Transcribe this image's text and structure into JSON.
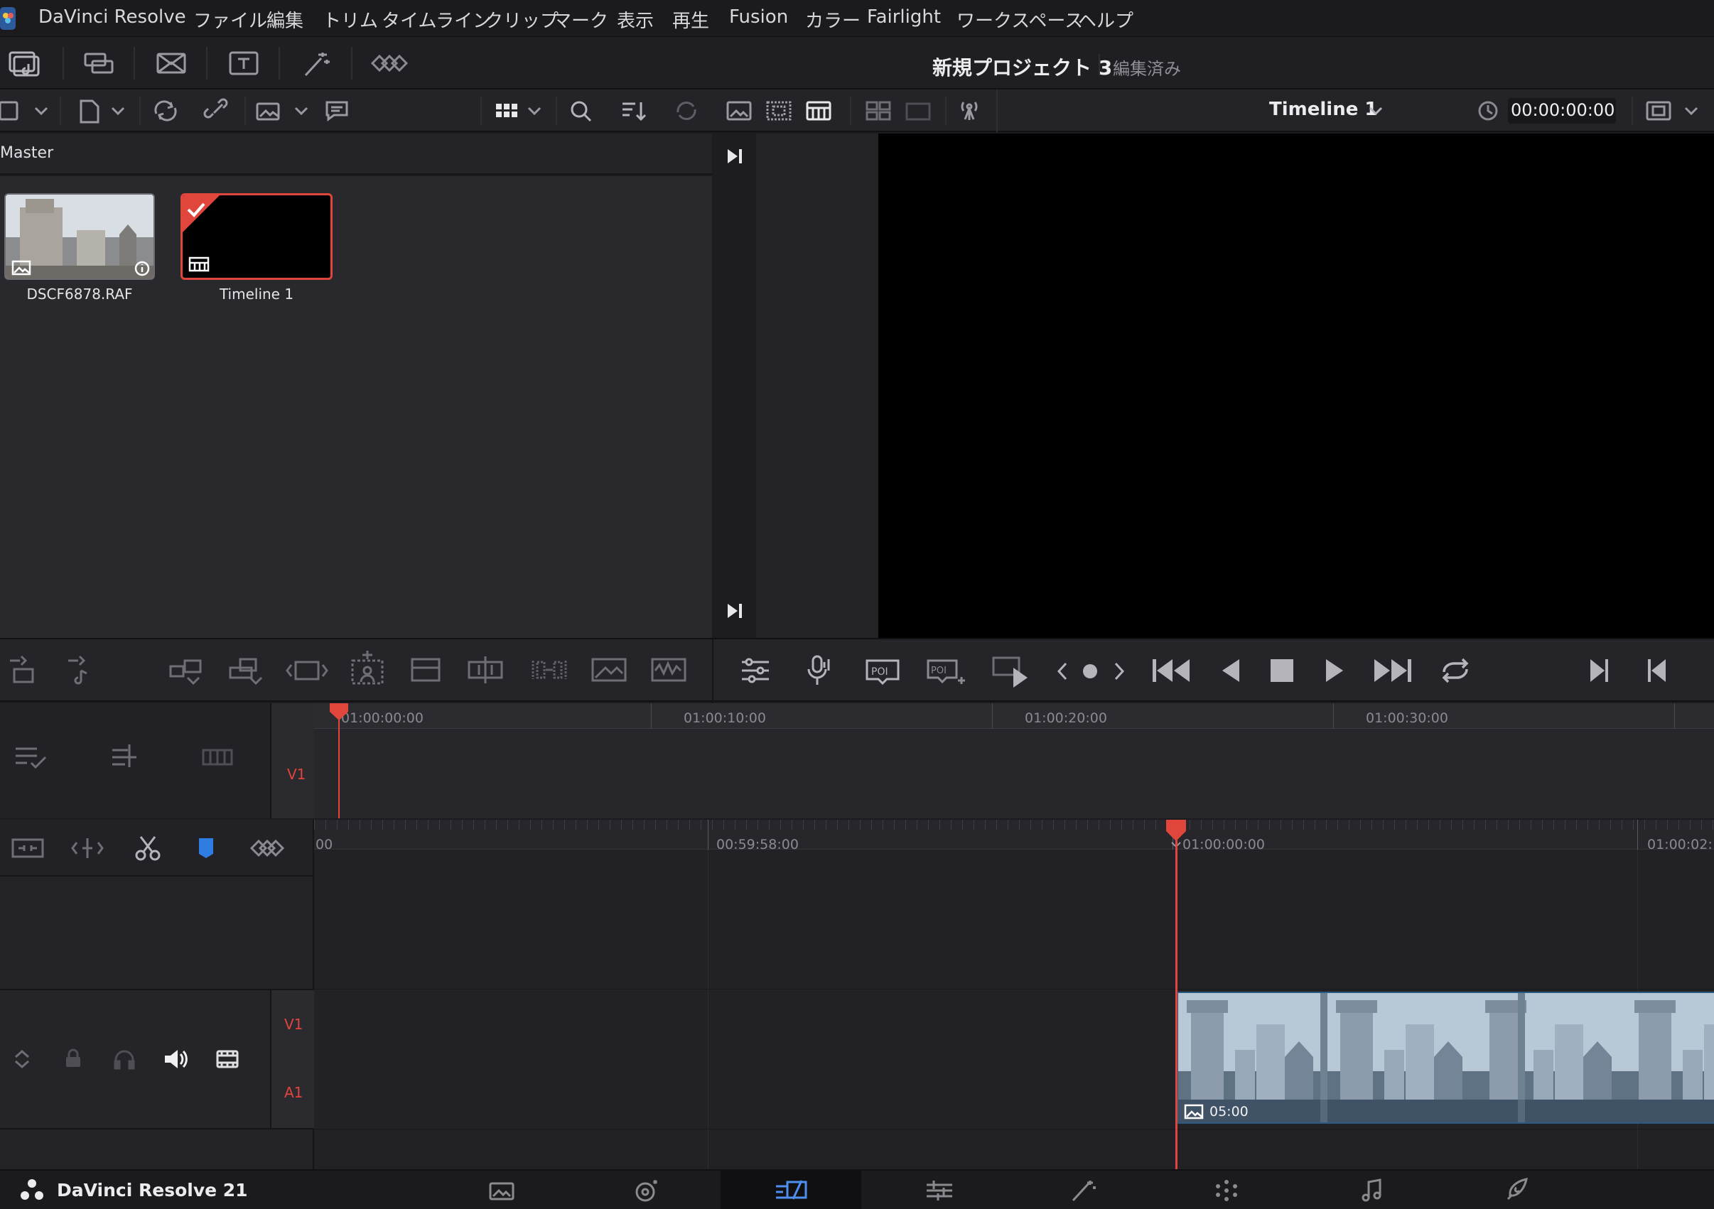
{
  "menu": {
    "items": [
      "DaVinci Resolve",
      "ファイル",
      "編集",
      "トリム",
      "タイムライン",
      "クリップ",
      "マーク",
      "表示",
      "再生",
      "Fusion",
      "カラー",
      "Fairlight",
      "ワークスペース",
      "ヘルプ"
    ]
  },
  "project": {
    "name": "新規プロジェクト 3",
    "status": "編集済み"
  },
  "media_pool": {
    "bin": "Master",
    "clips": [
      {
        "name": "DSCF6878.RAF",
        "type": "image",
        "selected": false
      },
      {
        "name": "Timeline 1",
        "type": "timeline",
        "selected": true
      }
    ]
  },
  "viewer": {
    "timeline_name": "Timeline 1",
    "timecode": "00:00:00:00"
  },
  "timeline_upper": {
    "ruler": [
      "01:00:00:00",
      "01:00:10:00",
      "01:00:20:00",
      "01:00:30:00"
    ],
    "track": "V1"
  },
  "timeline_lower": {
    "ruler": [
      "00",
      "00:59:58:00",
      "01:00:00:00",
      "01:00:02:"
    ],
    "tracks": [
      "V1",
      "A1"
    ],
    "clip_duration": "05:00"
  },
  "bottom": {
    "app_name": "DaVinci Resolve 21"
  },
  "colors": {
    "accent": "#e0463b",
    "background": "#1c1c20",
    "viewer": "#000000"
  }
}
